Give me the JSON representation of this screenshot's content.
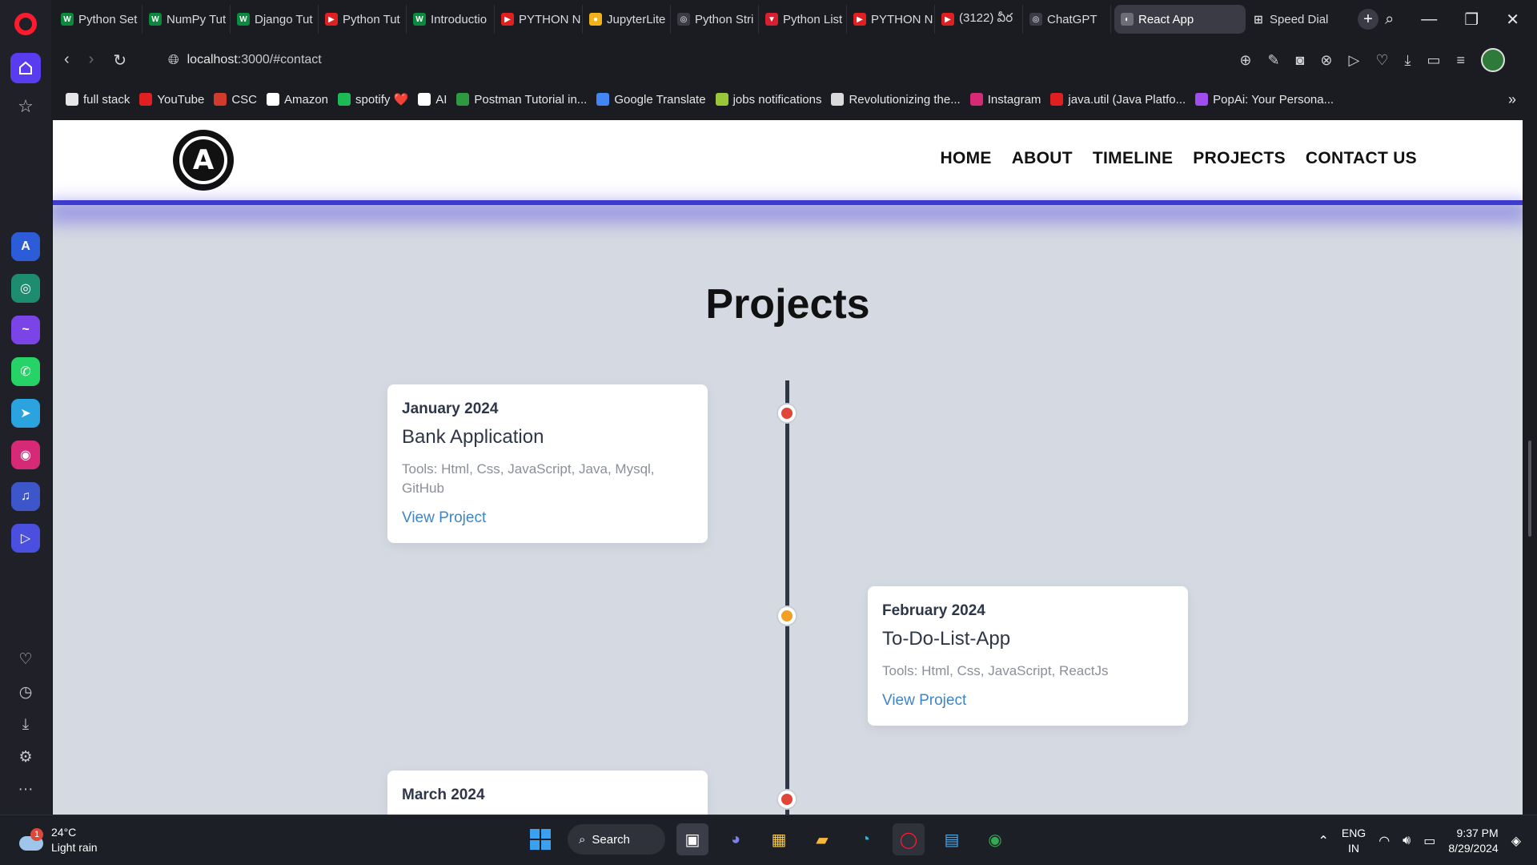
{
  "browser": {
    "tabs": [
      {
        "label": "Python Set",
        "color": "#0a8a3c",
        "glyph": "W"
      },
      {
        "label": "NumPy Tut",
        "color": "#0a8a3c",
        "glyph": "W"
      },
      {
        "label": "Django Tut",
        "color": "#0a8a3c",
        "glyph": "W"
      },
      {
        "label": "Python Tut",
        "color": "#e02020",
        "glyph": "▶"
      },
      {
        "label": "Introductio",
        "color": "#0a8a3c",
        "glyph": "W"
      },
      {
        "label": "PYTHON N",
        "color": "#e02020",
        "glyph": "▶"
      },
      {
        "label": "JupyterLite",
        "color": "#f2b21a",
        "glyph": "●"
      },
      {
        "label": "Python Stri",
        "color": "#3a3b45",
        "glyph": "◎"
      },
      {
        "label": "Python List",
        "color": "#d61f2f",
        "glyph": "▼"
      },
      {
        "label": "PYTHON N",
        "color": "#e02020",
        "glyph": "▶"
      },
      {
        "label": "(3122) వీర",
        "color": "#e02020",
        "glyph": "▶"
      },
      {
        "label": "ChatGPT",
        "color": "#3a3b45",
        "glyph": "◎"
      }
    ],
    "active_tab": "React App",
    "speed_dial": "Speed Dial",
    "url_host": "localhost",
    "url_rest": ":3000/#contact",
    "bookmarks": [
      {
        "label": "full stack",
        "color": "#e6e6e6"
      },
      {
        "label": "YouTube",
        "color": "#e02020"
      },
      {
        "label": "CSC",
        "color": "#d13b2b"
      },
      {
        "label": "Amazon",
        "color": "#ffffff"
      },
      {
        "label": "spotify ❤️",
        "color": "#1db954"
      },
      {
        "label": "AI",
        "color": "#ffffff"
      },
      {
        "label": "Postman Tutorial in...",
        "color": "#2e9a3f"
      },
      {
        "label": "Google Translate",
        "color": "#4285f4"
      },
      {
        "label": "jobs notifications",
        "color": "#9ac73a"
      },
      {
        "label": "Revolutionizing the...",
        "color": "#dadada"
      },
      {
        "label": "Instagram",
        "color": "#d62976"
      },
      {
        "label": "java.util (Java Platfo...",
        "color": "#e02020"
      },
      {
        "label": "PopAi: Your Persona...",
        "color": "#a04df0"
      }
    ]
  },
  "site": {
    "logo_letter": "A",
    "nav": [
      "HOME",
      "ABOUT",
      "TIMELINE",
      "PROJECTS",
      "CONTACT US"
    ],
    "section_title": "Projects",
    "projects": [
      {
        "date": "January 2024",
        "name": "Bank Application",
        "tools": "Tools: Html, Css, JavaScript, Java, Mysql, GitHub",
        "link": "View Project",
        "dot_color": "#e0463a"
      },
      {
        "date": "February 2024",
        "name": "To-Do-List-App",
        "tools": "Tools: Html, Css, JavaScript, ReactJs",
        "link": "View Project",
        "dot_color": "#f0a024"
      },
      {
        "date": "March 2024",
        "dot_color": "#e0463a"
      }
    ]
  },
  "taskbar": {
    "weather_temp": "24°C",
    "weather_desc": "Light rain",
    "weather_badge": "1",
    "search_label": "Search",
    "lang_top": "ENG",
    "lang_bottom": "IN",
    "time": "9:37 PM",
    "date": "8/29/2024"
  }
}
